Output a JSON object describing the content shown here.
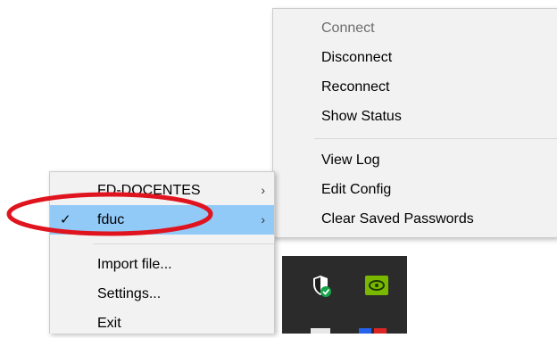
{
  "main_menu": {
    "items": [
      {
        "label": "FD-DOCENTES",
        "has_submenu": true,
        "checked": false
      },
      {
        "label": "fduc",
        "has_submenu": true,
        "checked": true,
        "selected": true
      },
      {
        "label": "Import file...",
        "has_submenu": false
      },
      {
        "label": "Settings...",
        "has_submenu": false
      },
      {
        "label": "Exit",
        "has_submenu": false
      }
    ],
    "submenu_arrow": "›",
    "check_mark": "✓"
  },
  "sub_menu": {
    "items": [
      {
        "label": "Connect",
        "disabled": true
      },
      {
        "label": "Disconnect"
      },
      {
        "label": "Reconnect"
      },
      {
        "label": "Show Status"
      },
      {
        "label": "View Log"
      },
      {
        "label": "Edit Config"
      },
      {
        "label": "Clear Saved Passwords"
      }
    ]
  },
  "tray": {
    "icons": [
      "windows-security-shield-icon",
      "nvidia-icon"
    ]
  },
  "colors": {
    "menu_background": "#f2f2f2",
    "selected_item": "#91c9f7",
    "disabled_text": "#6d6d6d",
    "taskbar": "#2b2b2b",
    "annotation_ellipse": "#e0141e"
  }
}
